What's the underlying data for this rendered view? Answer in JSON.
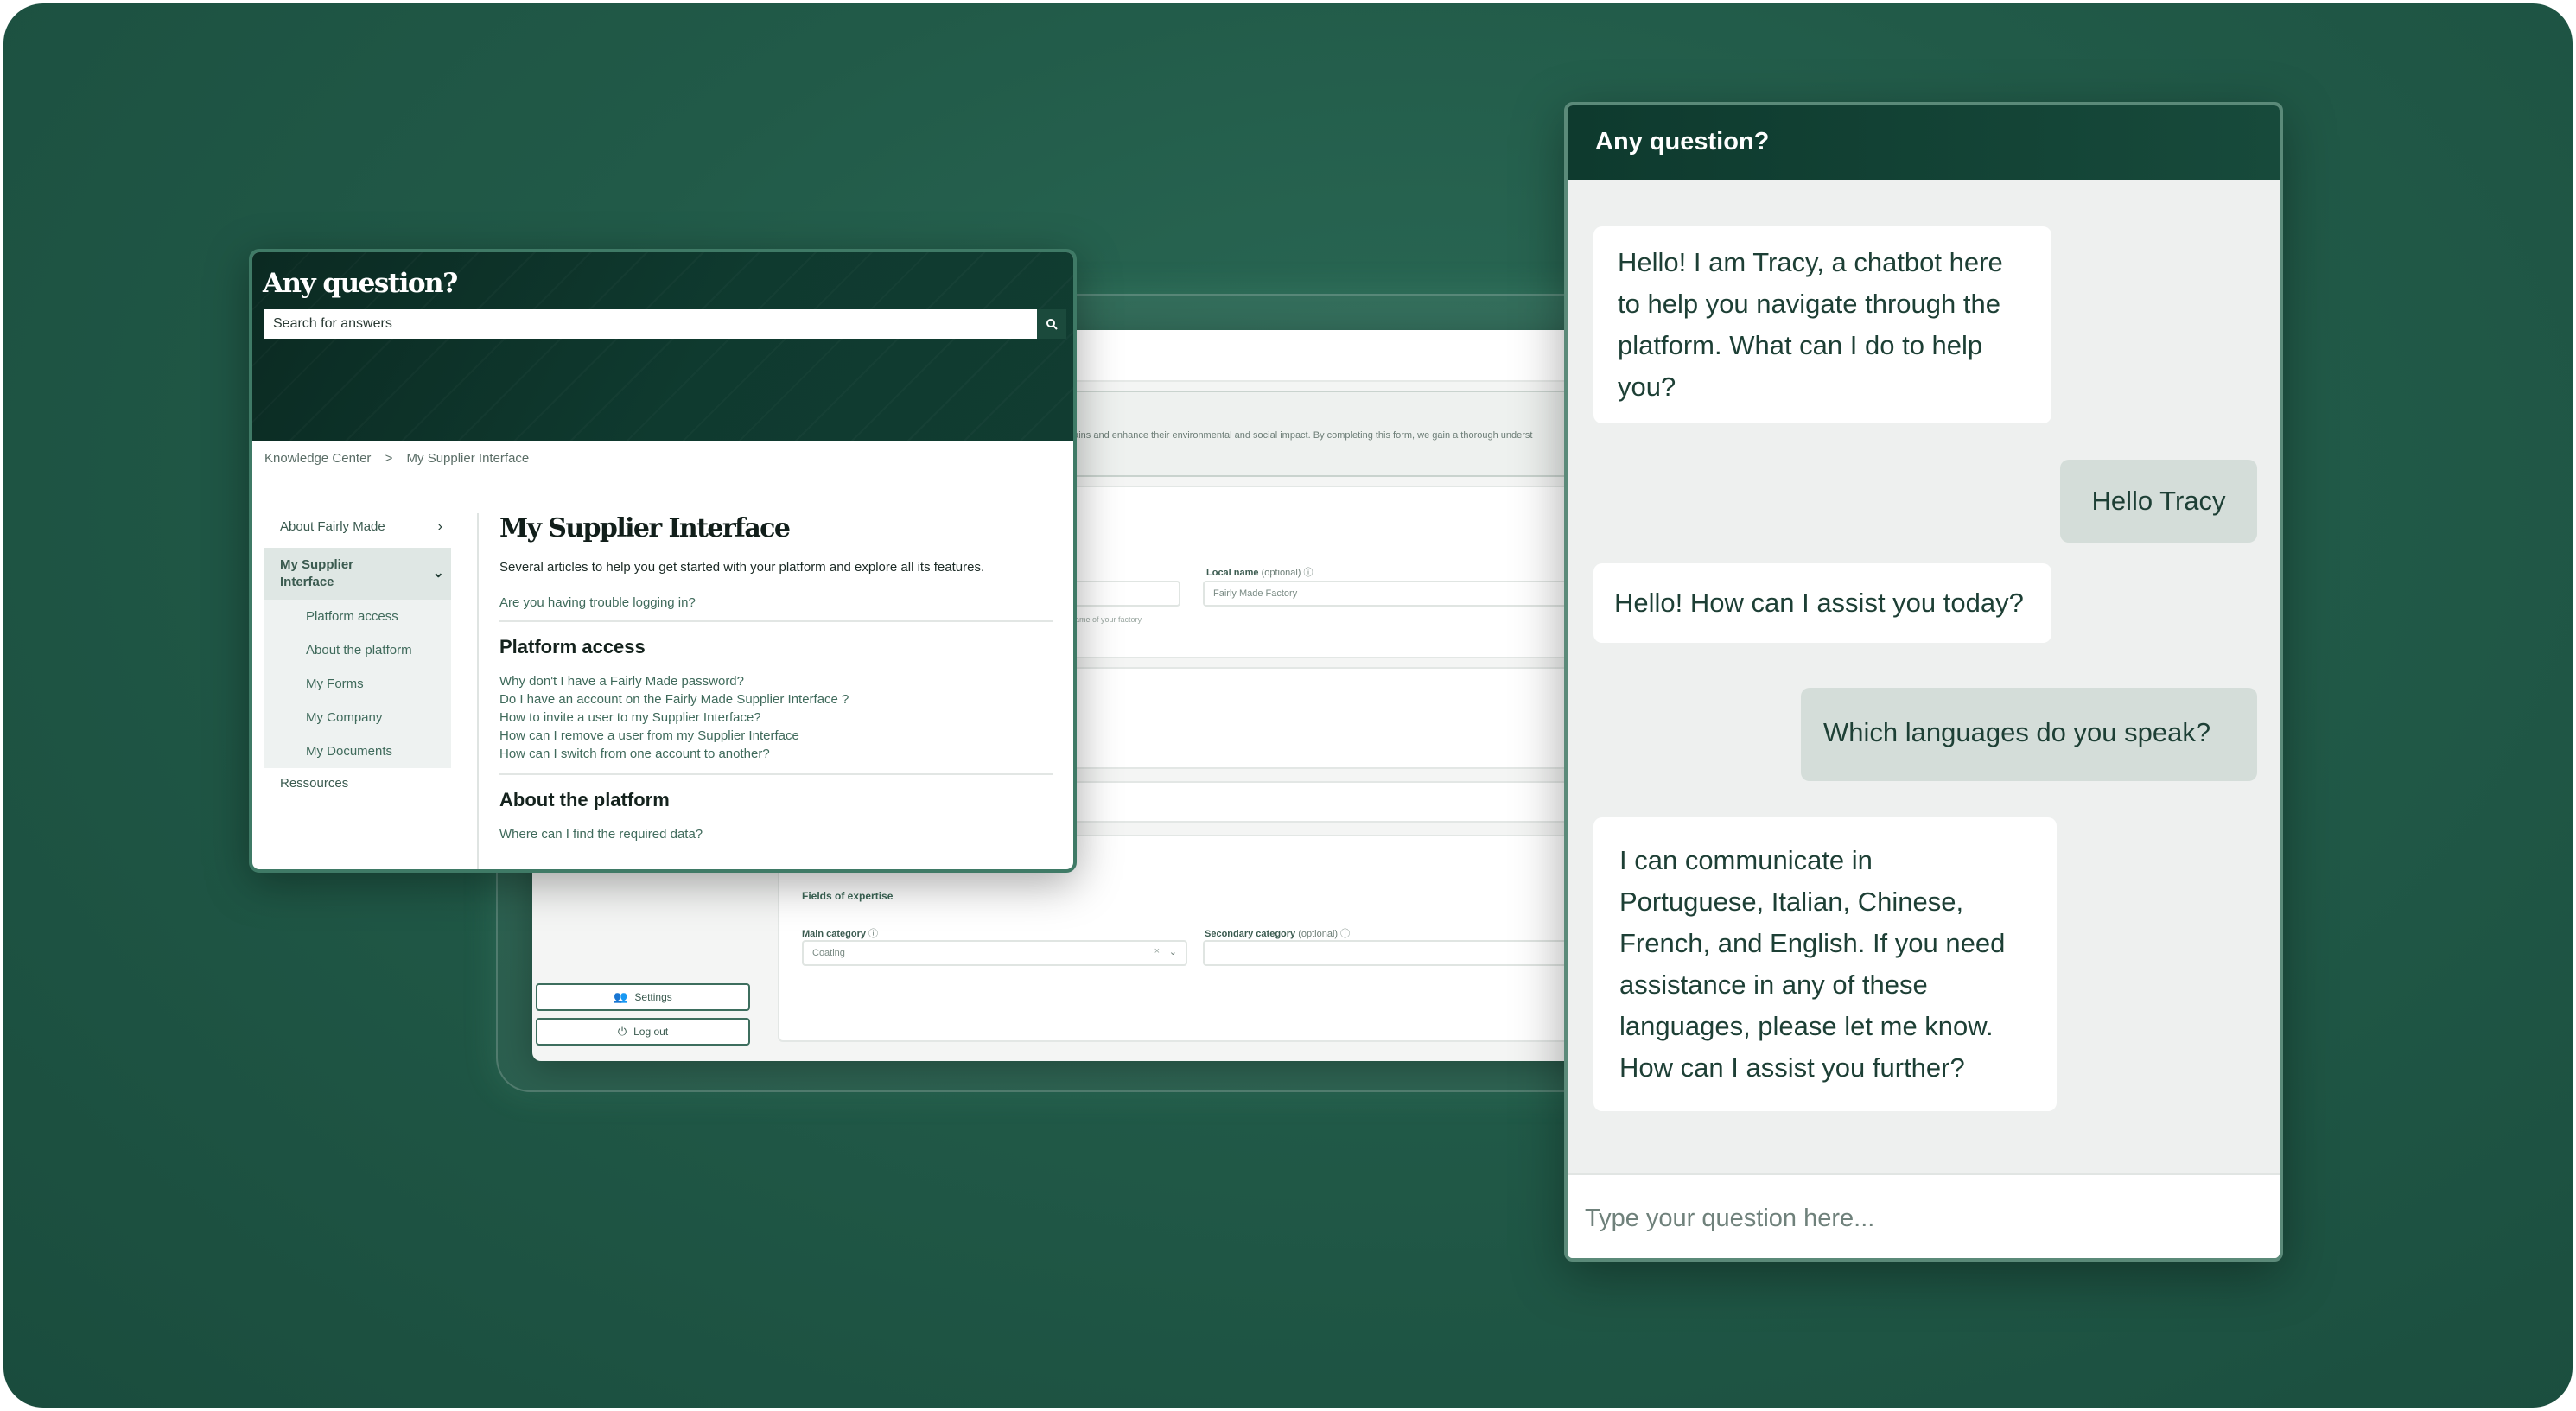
{
  "platform": {
    "info_text": "hains and enhance their environmental and social impact. By completing this form, we gain a thorough underst",
    "local_name_label": "Local name",
    "local_name_optional": "(optional)",
    "local_name_value": "Fairly Made Factory",
    "name_hint": "ame of your factory",
    "fields_title": "Fields of expertise",
    "main_category_label": "Main category",
    "main_category_value": "Coating",
    "secondary_category_label": "Secondary category",
    "secondary_category_optional": "(optional)",
    "settings_label": "Settings",
    "logout_label": "Log out"
  },
  "knowledge": {
    "title": "Any question?",
    "search_placeholder": "Search for answers",
    "breadcrumb": [
      "Knowledge Center",
      ">",
      "My Supplier Interface"
    ],
    "sidebar": {
      "about": "About Fairly Made",
      "group_title": "My Supplier Interface",
      "group_items": [
        "Platform access",
        "About the platform",
        "My Forms",
        "My Company",
        "My Documents"
      ],
      "resources": "Ressources"
    },
    "page_title": "My Supplier Interface",
    "lead": "Several articles to help you get started with your platform and explore all its features.",
    "trouble_link": "Are you having trouble logging in?",
    "section1_title": "Platform access",
    "section1_links": [
      "Why don't I have a Fairly Made password?",
      "Do I have an account on the Fairly Made Supplier Interface ?",
      "How to invite a user to my Supplier Interface?",
      "How can I remove a user from my Supplier Interface",
      "How can I switch from one account to another?"
    ],
    "section2_title": "About the platform",
    "section2_links": [
      "Where can I find the required data?"
    ]
  },
  "chat": {
    "title": "Any question?",
    "messages": [
      {
        "from": "bot",
        "lines": [
          "Hello! I am Tracy, a chatbot here",
          "to help you navigate through the",
          "platform. What can I do to help",
          "you?"
        ]
      },
      {
        "from": "user",
        "lines": [
          "Hello Tracy"
        ]
      },
      {
        "from": "bot",
        "lines": [
          "Hello! How can I assist you today?"
        ]
      },
      {
        "from": "user",
        "lines": [
          "Which languages do you speak?"
        ]
      },
      {
        "from": "bot",
        "lines": [
          "I can communicate in",
          "Portuguese, Italian, Chinese,",
          "French, and English. If you need",
          "assistance in any of these",
          "languages, please let me know.",
          "How can I assist you further?"
        ]
      }
    ],
    "input_placeholder": "Type your question here..."
  }
}
